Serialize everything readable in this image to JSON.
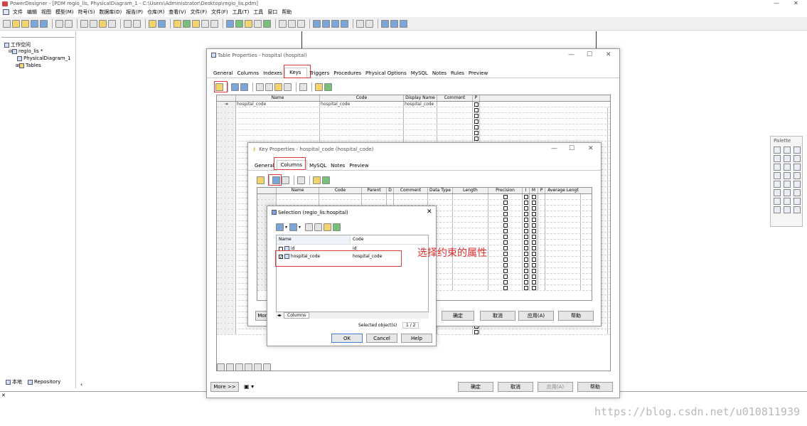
{
  "app": {
    "title": "PowerDesigner - [PDM regio_lis, PhysicalDiagram_1 - C:\\Users\\Administrator\\Desktop\\regio_lis.pdm]",
    "min": "—",
    "close": "✕"
  },
  "menu": [
    "文件",
    "编辑",
    "视图",
    "模型(M)",
    "符号(S)",
    "数据库(D)",
    "报告(P)",
    "仓库(R)",
    "查看(V)",
    "文件(F)",
    "文件(F)",
    "工具(T)",
    "工具",
    "窗口",
    "帮助"
  ],
  "tree": {
    "workspace": "工作空间",
    "model": "regio_lis *",
    "diagram": "PhysicalDiagram_1",
    "tables": "Tables"
  },
  "bottom_tabs": {
    "local": "本地",
    "repository": "Repository"
  },
  "palette": {
    "title": "Palette"
  },
  "table_props": {
    "title": "Table Properties - hospital (hospital)",
    "tabs": [
      "General",
      "Columns",
      "Indexes",
      "Keys",
      "Triggers",
      "Procedures",
      "Physical Options",
      "MySQL",
      "Notes",
      "Rules",
      "Preview"
    ],
    "active_tab": "Keys",
    "columns": [
      "Name",
      "Code",
      "Display Name",
      "Comment",
      "P"
    ],
    "rows": [
      {
        "name": "hospital_code",
        "code": "hospital_code",
        "display": "hospital_code",
        "comment": ""
      }
    ],
    "buttons": {
      "more": "More >>",
      "ok": "确定",
      "cancel": "取消",
      "apply": "应用(A)",
      "help": "帮助"
    }
  },
  "key_props": {
    "title": "Key Properties - hospital_code (hospital_code)",
    "tabs": [
      "General",
      "Columns",
      "MySQL",
      "Notes",
      "Preview"
    ],
    "active_tab": "Columns",
    "columns": [
      "Name",
      "Code",
      "Parent",
      "D",
      "Comment",
      "Data Type",
      "Length",
      "Precision",
      "I",
      "M",
      "P",
      "Average Lengt"
    ],
    "buttons": {
      "more": "More",
      "ok": "确定",
      "cancel": "取消",
      "apply": "应用(A)",
      "help": "帮助"
    }
  },
  "selection": {
    "title": "Selection (regio_lis:hospital)",
    "columns": [
      "Name",
      "Code"
    ],
    "rows": [
      {
        "name": "id",
        "code": "id",
        "checked": false
      },
      {
        "name": "hospital_code",
        "code": "hospital_code",
        "checked": true
      }
    ],
    "tab": "Columns",
    "selected_label": "Selected object(s)",
    "selected_count": "1 / 2",
    "buttons": {
      "ok": "OK",
      "cancel": "Cancel",
      "help": "Help"
    }
  },
  "annotation": "选择约束的属性",
  "watermark": "https://blog.csdn.net/u010811939"
}
